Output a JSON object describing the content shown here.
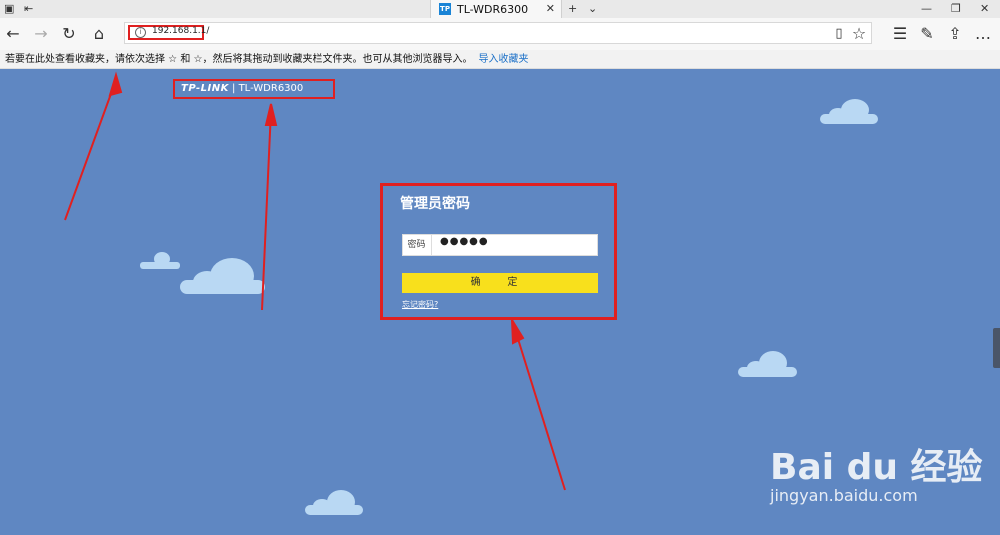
{
  "browser": {
    "tab_title": "TL-WDR6300",
    "tab_favicon_text": "TP",
    "address_url": "192.168.1.1/",
    "favorites_bar_text": "若要在此处查看收藏夹，请依次选择 ☆ 和 ☆，然后将其拖动到收藏夹栏文件夹。也可从其他浏览器导入。",
    "favorites_import_link": "导入收藏夹"
  },
  "page": {
    "logo_brand": "TP-LINK",
    "logo_model": "TL-WDR6300",
    "login_title": "管理员密码",
    "password_label": "密码",
    "password_value": "●●●●●",
    "confirm_button": "确 定",
    "forgot_link": "忘记密码?"
  },
  "watermark": {
    "brand": "Bai du 经验",
    "url": "jingyan.baidu.com"
  },
  "colors": {
    "page_bg": "#5f87c2",
    "highlight": "#e02020",
    "confirm_bg": "#f8e01c",
    "cloud": "#b9d8f3"
  }
}
